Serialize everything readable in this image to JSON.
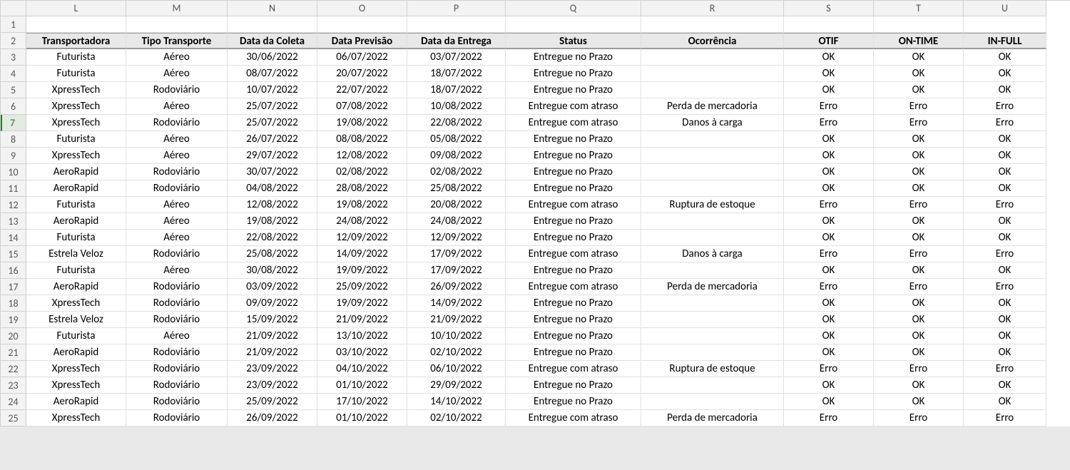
{
  "columns": [
    "L",
    "M",
    "N",
    "O",
    "P",
    "Q",
    "R",
    "S",
    "T",
    "U"
  ],
  "headers": [
    "Transportadora",
    "Tipo Transporte",
    "Data da Coleta",
    "Data Previsão",
    "Data da Entrega",
    "Status",
    "Ocorrência",
    "OTIF",
    "ON-TIME",
    "IN-FULL"
  ],
  "selected_row": 7,
  "chart_data": {
    "type": "table",
    "title": "",
    "xlabel": "",
    "ylabel": "",
    "columns": [
      "Transportadora",
      "Tipo Transporte",
      "Data da Coleta",
      "Data Previsão",
      "Data da Entrega",
      "Status",
      "Ocorrência",
      "OTIF",
      "ON-TIME",
      "IN-FULL"
    ],
    "rows": [
      [
        "Futurista",
        "Aéreo",
        "30/06/2022",
        "06/07/2022",
        "03/07/2022",
        "Entregue no Prazo",
        "",
        "OK",
        "OK",
        "OK"
      ],
      [
        "Futurista",
        "Aéreo",
        "08/07/2022",
        "20/07/2022",
        "18/07/2022",
        "Entregue no Prazo",
        "",
        "OK",
        "OK",
        "OK"
      ],
      [
        "XpressTech",
        "Rodoviário",
        "10/07/2022",
        "22/07/2022",
        "18/07/2022",
        "Entregue no Prazo",
        "",
        "OK",
        "OK",
        "OK"
      ],
      [
        "XpressTech",
        "Aéreo",
        "25/07/2022",
        "07/08/2022",
        "10/08/2022",
        "Entregue com atraso",
        "Perda de mercadoria",
        "Erro",
        "Erro",
        "Erro"
      ],
      [
        "XpressTech",
        "Rodoviário",
        "25/07/2022",
        "19/08/2022",
        "22/08/2022",
        "Entregue com atraso",
        "Danos à carga",
        "Erro",
        "Erro",
        "Erro"
      ],
      [
        "Futurista",
        "Aéreo",
        "26/07/2022",
        "08/08/2022",
        "05/08/2022",
        "Entregue no Prazo",
        "",
        "OK",
        "OK",
        "OK"
      ],
      [
        "XpressTech",
        "Aéreo",
        "29/07/2022",
        "12/08/2022",
        "09/08/2022",
        "Entregue no Prazo",
        "",
        "OK",
        "OK",
        "OK"
      ],
      [
        "AeroRapid",
        "Rodoviário",
        "30/07/2022",
        "02/08/2022",
        "02/08/2022",
        "Entregue no Prazo",
        "",
        "OK",
        "OK",
        "OK"
      ],
      [
        "AeroRapid",
        "Rodoviário",
        "04/08/2022",
        "28/08/2022",
        "25/08/2022",
        "Entregue no Prazo",
        "",
        "OK",
        "OK",
        "OK"
      ],
      [
        "Futurista",
        "Aéreo",
        "12/08/2022",
        "19/08/2022",
        "20/08/2022",
        "Entregue com atraso",
        "Ruptura de estoque",
        "Erro",
        "Erro",
        "Erro"
      ],
      [
        "AeroRapid",
        "Aéreo",
        "19/08/2022",
        "24/08/2022",
        "24/08/2022",
        "Entregue no Prazo",
        "",
        "OK",
        "OK",
        "OK"
      ],
      [
        "Futurista",
        "Aéreo",
        "22/08/2022",
        "12/09/2022",
        "12/09/2022",
        "Entregue no Prazo",
        "",
        "OK",
        "OK",
        "OK"
      ],
      [
        "Estrela Veloz",
        "Rodoviário",
        "25/08/2022",
        "14/09/2022",
        "17/09/2022",
        "Entregue com atraso",
        "Danos à carga",
        "Erro",
        "Erro",
        "Erro"
      ],
      [
        "Futurista",
        "Aéreo",
        "30/08/2022",
        "19/09/2022",
        "17/09/2022",
        "Entregue no Prazo",
        "",
        "OK",
        "OK",
        "OK"
      ],
      [
        "AeroRapid",
        "Rodoviário",
        "03/09/2022",
        "25/09/2022",
        "26/09/2022",
        "Entregue com atraso",
        "Perda de mercadoria",
        "Erro",
        "Erro",
        "Erro"
      ],
      [
        "XpressTech",
        "Rodoviário",
        "09/09/2022",
        "19/09/2022",
        "14/09/2022",
        "Entregue no Prazo",
        "",
        "OK",
        "OK",
        "OK"
      ],
      [
        "Estrela Veloz",
        "Rodoviário",
        "15/09/2022",
        "21/09/2022",
        "21/09/2022",
        "Entregue no Prazo",
        "",
        "OK",
        "OK",
        "OK"
      ],
      [
        "Futurista",
        "Aéreo",
        "21/09/2022",
        "13/10/2022",
        "10/10/2022",
        "Entregue no Prazo",
        "",
        "OK",
        "OK",
        "OK"
      ],
      [
        "AeroRapid",
        "Rodoviário",
        "21/09/2022",
        "03/10/2022",
        "02/10/2022",
        "Entregue no Prazo",
        "",
        "OK",
        "OK",
        "OK"
      ],
      [
        "XpressTech",
        "Rodoviário",
        "23/09/2022",
        "04/10/2022",
        "06/10/2022",
        "Entregue com atraso",
        "Ruptura de estoque",
        "Erro",
        "Erro",
        "Erro"
      ],
      [
        "XpressTech",
        "Rodoviário",
        "23/09/2022",
        "01/10/2022",
        "29/09/2022",
        "Entregue no Prazo",
        "",
        "OK",
        "OK",
        "OK"
      ],
      [
        "AeroRapid",
        "Rodoviário",
        "25/09/2022",
        "17/10/2022",
        "14/10/2022",
        "Entregue no Prazo",
        "",
        "OK",
        "OK",
        "OK"
      ],
      [
        "XpressTech",
        "Rodoviário",
        "26/09/2022",
        "01/10/2022",
        "02/10/2022",
        "Entregue com atraso",
        "Perda de mercadoria",
        "Erro",
        "Erro",
        "Erro"
      ]
    ]
  }
}
